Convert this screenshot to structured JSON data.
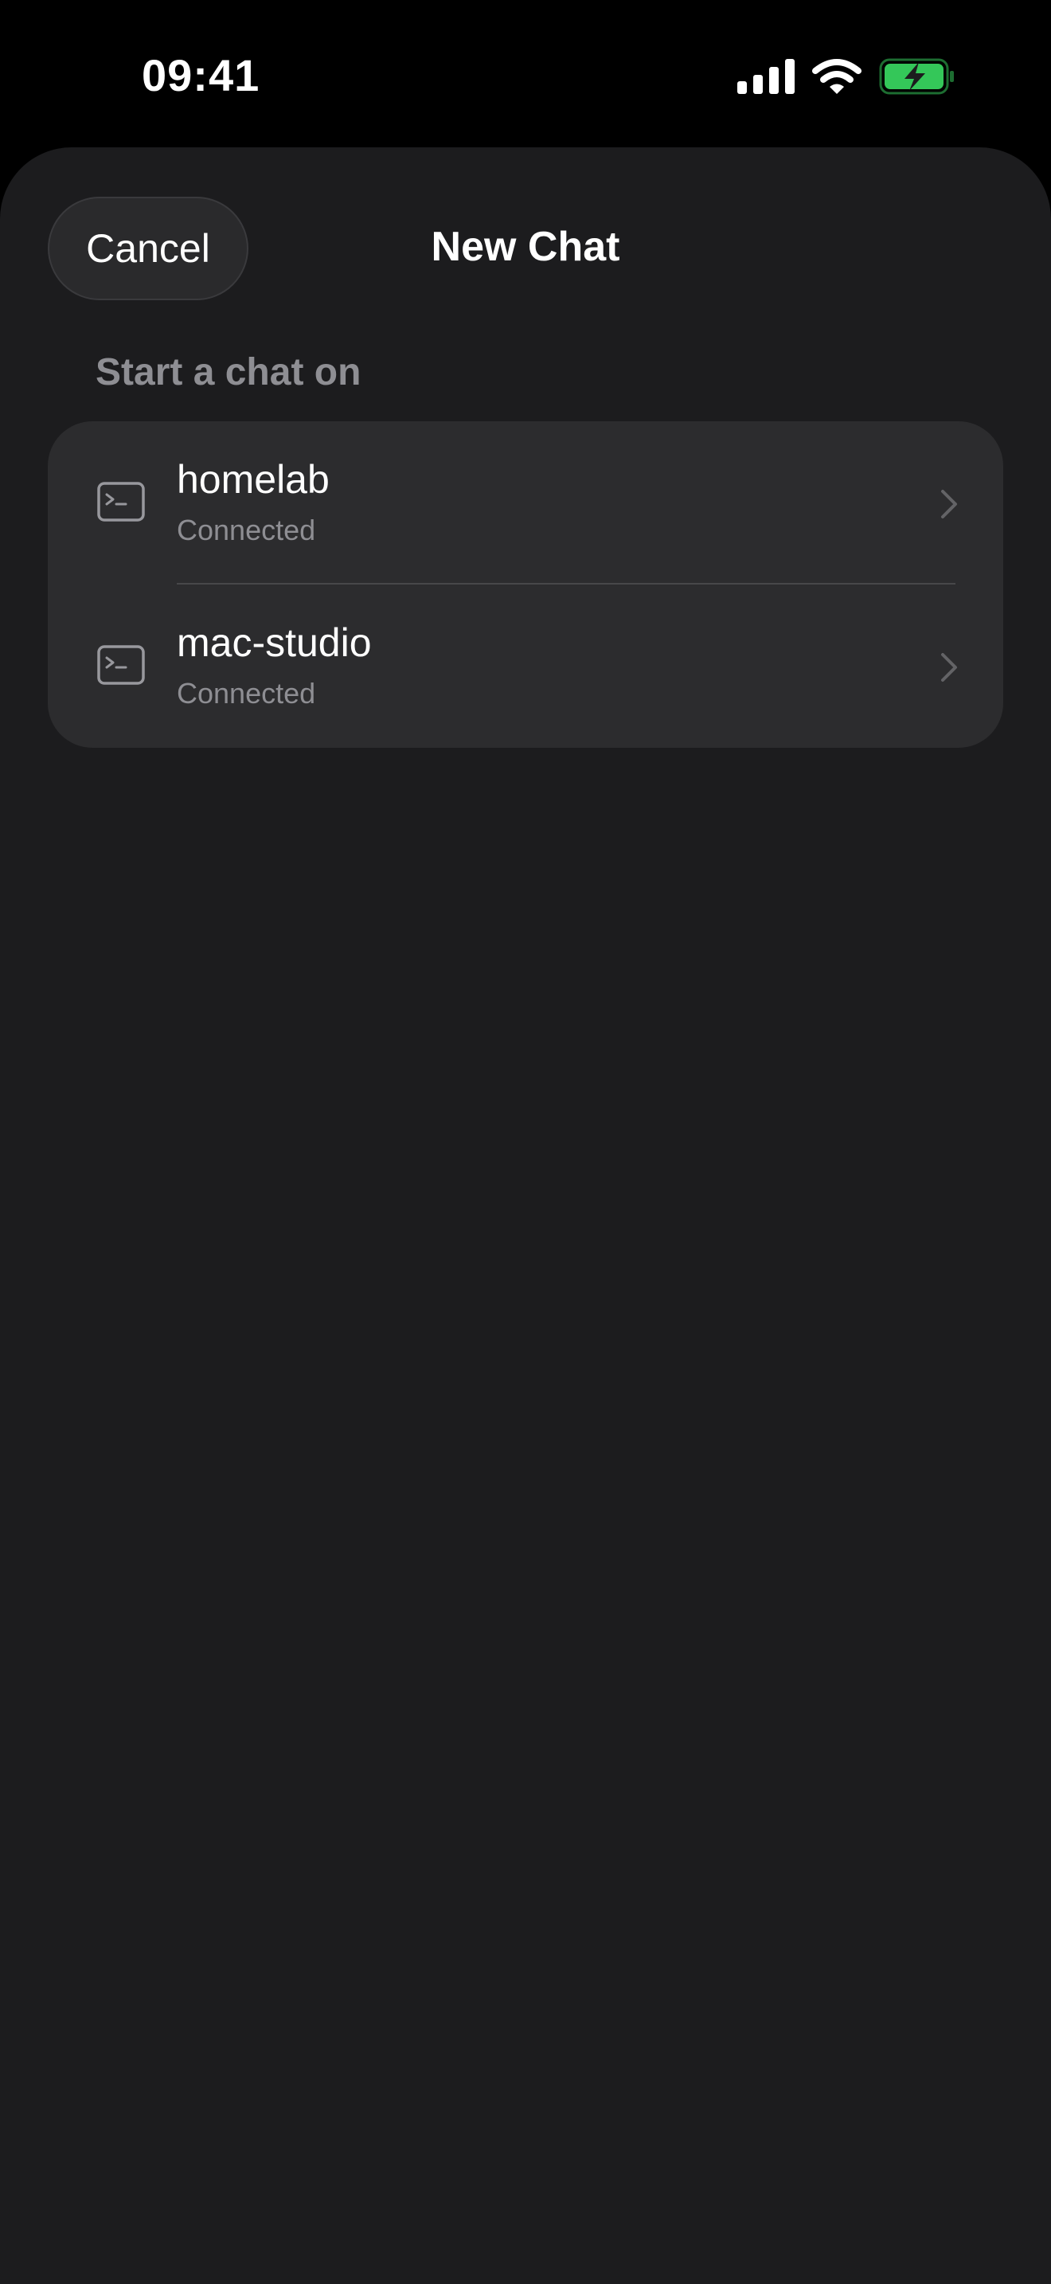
{
  "status_bar": {
    "time": "09:41",
    "icons": [
      "cellular-signal-icon",
      "wifi-icon",
      "battery-charging-icon"
    ],
    "battery_color": "#34c759"
  },
  "header": {
    "cancel_label": "Cancel",
    "title": "New Chat"
  },
  "section": {
    "header": "Start a chat on"
  },
  "hosts": [
    {
      "name": "homelab",
      "status": "Connected",
      "icon": "terminal-icon"
    },
    {
      "name": "mac-studio",
      "status": "Connected",
      "icon": "terminal-icon"
    }
  ],
  "colors": {
    "background": "#1c1c1e",
    "card": "#2c2c2e",
    "secondary_text": "#8e8e93"
  }
}
